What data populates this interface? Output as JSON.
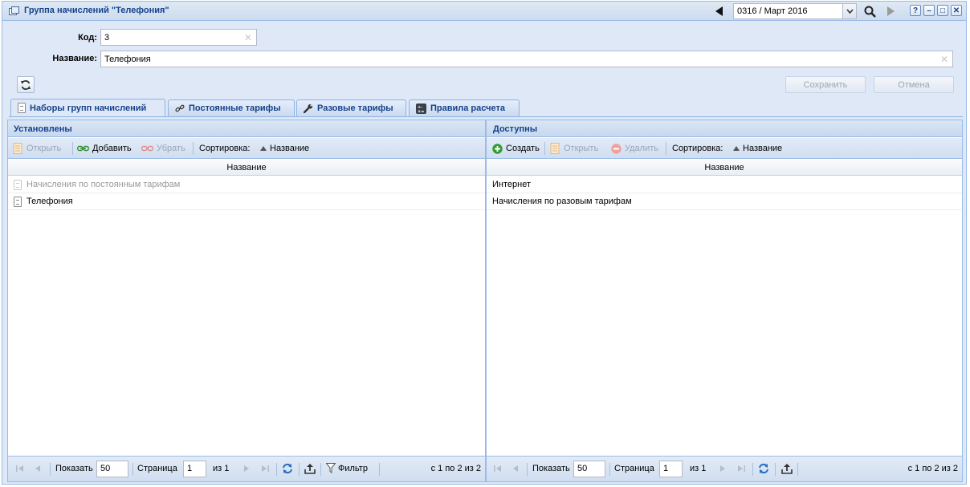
{
  "window": {
    "title": "Группа начислений \"Телефония\"",
    "period": "0316 / Март 2016"
  },
  "form": {
    "code_label": "Код:",
    "code_value": "3",
    "name_label": "Название:",
    "name_value": "Телефония",
    "save_label": "Сохранить",
    "cancel_label": "Отмена"
  },
  "tabs": [
    {
      "label": "Наборы групп начислений",
      "icon": "document-icon",
      "active": true
    },
    {
      "label": "Постоянные тарифы",
      "icon": "link-icon",
      "active": false
    },
    {
      "label": "Разовые тарифы",
      "icon": "wrench-icon",
      "active": false
    },
    {
      "label": "Правила расчета",
      "icon": "calculator-icon",
      "active": false
    }
  ],
  "left_panel": {
    "title": "Установлены",
    "toolbar": {
      "open": "Открыть",
      "add": "Добавить",
      "remove": "Убрать",
      "sort_label": "Сортировка:",
      "sort_field": "Название"
    },
    "column": "Название",
    "rows": [
      {
        "name": "Начисления по постоянным тарифам",
        "muted": true
      },
      {
        "name": "Телефония",
        "muted": false
      }
    ],
    "pager": {
      "show_label": "Показать",
      "page_size": "50",
      "page_label": "Страница",
      "page": "1",
      "of_label": "из 1",
      "filter_label": "Фильтр",
      "summary": "с 1 по 2 из 2"
    }
  },
  "right_panel": {
    "title": "Доступны",
    "toolbar": {
      "create": "Создать",
      "open": "Открыть",
      "delete": "Удалить",
      "sort_label": "Сортировка:",
      "sort_field": "Название"
    },
    "column": "Название",
    "rows": [
      {
        "name": "Интернет"
      },
      {
        "name": "Начисления по разовым тарифам"
      }
    ],
    "pager": {
      "show_label": "Показать",
      "page_size": "50",
      "page_label": "Страница",
      "page": "1",
      "of_label": "из 1",
      "summary": "с 1 по 2 из 2"
    }
  },
  "colors": {
    "accent": "#15428b",
    "border": "#99bbe8",
    "background": "#dfe8f6",
    "create_green": "#2e9c2e",
    "delete_red": "#e06060"
  }
}
